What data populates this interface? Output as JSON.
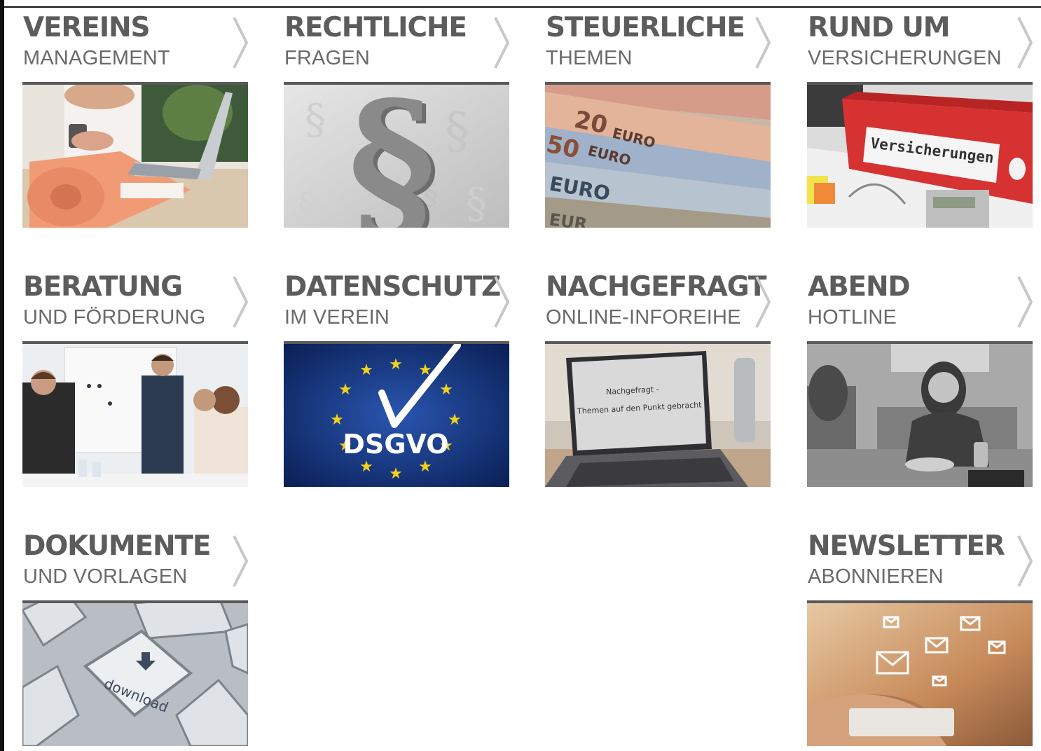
{
  "tiles": [
    {
      "title": "VEREINS",
      "subtitle": "MANAGEMENT",
      "image": "yoga-mat-laptop-photo"
    },
    {
      "title": "RECHTLICHE",
      "subtitle": "FRAGEN",
      "image": "paragraph-symbol-photo"
    },
    {
      "title": "STEUERLICHE",
      "subtitle": "THEMEN",
      "image": "euro-banknotes-photo"
    },
    {
      "title": "RUND UM",
      "subtitle": "VERSICHERUNGEN",
      "image": "insurance-binder-photo",
      "image_text": "Versicherungen"
    },
    {
      "title": "BERATUNG",
      "subtitle": "UND FÖRDERUNG",
      "image": "business-meeting-photo"
    },
    {
      "title": "DATENSCHUTZ",
      "subtitle": "IM VEREIN",
      "image": "dsgvo-checkmark-graphic",
      "image_text": "DSGVO"
    },
    {
      "title": "NACHGEFRAGT",
      "subtitle": "ONLINE-INFOREIHE",
      "image": "laptop-screen-photo",
      "image_text": [
        "Nachgefragt -",
        "Themen auf den Punkt gebracht"
      ]
    },
    {
      "title": "ABEND",
      "subtitle": "HOTLINE",
      "image": "woman-on-phone-photo"
    },
    {
      "title": "DOKUMENTE",
      "subtitle": "UND VORLAGEN",
      "image": "download-key-photo",
      "image_text": "download"
    },
    {
      "title": "NEWSLETTER",
      "subtitle": "ABONNIEREN",
      "image": "email-envelopes-photo"
    }
  ],
  "colors": {
    "title": "#5c5c5c",
    "subtitle": "#6a6a6a",
    "bar": "#5a5a5a",
    "chevron": "#c8c8c8"
  }
}
